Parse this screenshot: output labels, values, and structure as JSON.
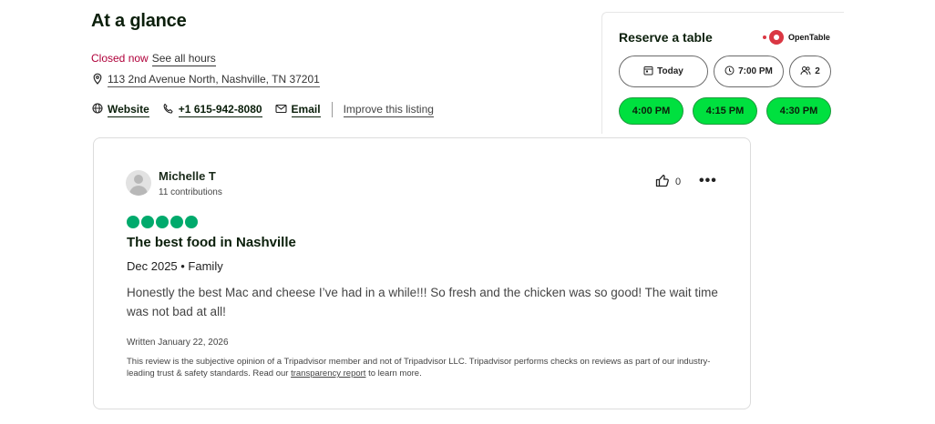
{
  "overview": {
    "heading": "At a glance",
    "status": "Closed now",
    "see_hours": "See all hours",
    "address": "113 2nd Avenue North, Nashville, TN 37201",
    "website": "Website",
    "phone": "+1 615-942-8080",
    "email": "Email",
    "improve": "Improve this listing"
  },
  "reserve": {
    "title": "Reserve a table",
    "provider": "OpenTable",
    "date": "Today",
    "time": "7:00 PM",
    "party": "2",
    "slots": [
      "4:00 PM",
      "4:15 PM",
      "4:30 PM"
    ]
  },
  "review": {
    "reviewer": "Michelle T",
    "contributions": "11 contributions",
    "likes": "0",
    "rating": 5,
    "title": "The best food in Nashville",
    "meta": "Dec 2025 • Family",
    "body": "Honestly the best Mac and cheese I’ve had in a while!!! So fresh and the chicken was so good! The wait time was not bad at all!",
    "written": "Written January 22, 2026",
    "disclaimer_pre": "This review is the subjective opinion of a Tripadvisor member and not of Tripadvisor LLC. Tripadvisor performs checks on reviews as part of our industry-leading trust & safety standards. Read our ",
    "disclaimer_link": "transparency report",
    "disclaimer_post": " to learn more."
  },
  "colors": {
    "accent_green": "#00e03f",
    "bubble_green": "#00aa6c",
    "closed_red": "#b0003a",
    "opentable_red": "#da3743"
  }
}
